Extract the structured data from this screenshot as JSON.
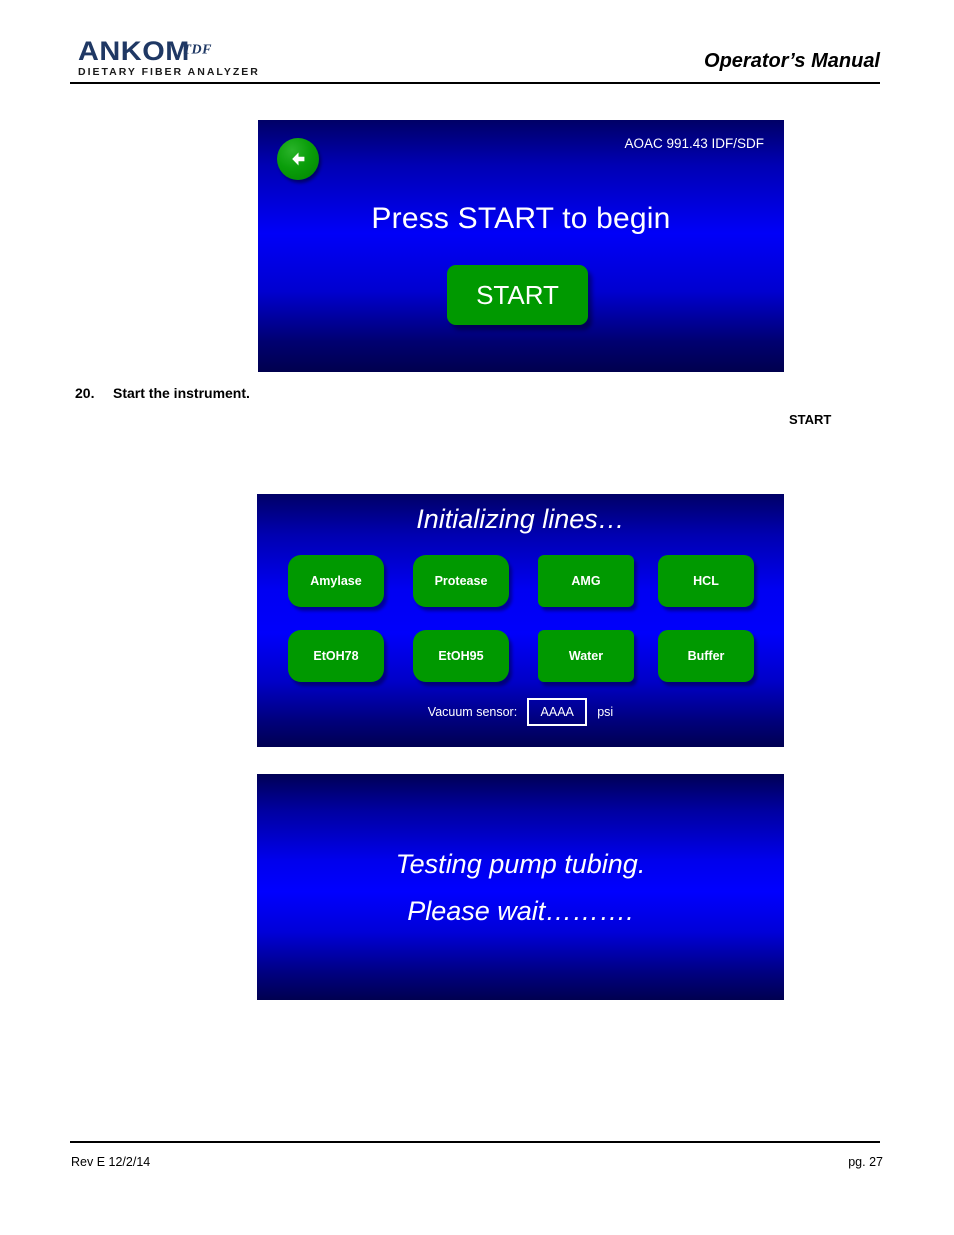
{
  "header": {
    "logo_main": "ANKOM",
    "logo_sup": "TDF",
    "logo_sub": "DIETARY FIBER ANALYZER",
    "title": "Operator’s Manual"
  },
  "screen_start": {
    "back_icon": "back-arrow-icon",
    "method_label": "AOAC 991.43 IDF/SDF",
    "prompt": "Press START to begin",
    "start_button": "START"
  },
  "step": {
    "number": "20.",
    "text": "Start the instrument.",
    "trailing_keyword": "START"
  },
  "screen_initializing": {
    "title": "Initializing lines…",
    "line_buttons": [
      {
        "label": "Amylase"
      },
      {
        "label": "Protease"
      },
      {
        "label": "AMG"
      },
      {
        "label": "HCL"
      },
      {
        "label": "EtOH78"
      },
      {
        "label": "EtOH95"
      },
      {
        "label": "Water"
      },
      {
        "label": "Buffer"
      }
    ],
    "vacuum_label": "Vacuum sensor:",
    "vacuum_value": "AAAA",
    "vacuum_unit": "psi"
  },
  "screen_testing": {
    "line1": "Testing pump tubing.",
    "line2": "Please wait………."
  },
  "footer": {
    "revision": "Rev E 12/2/14",
    "page": "pg. 27"
  },
  "colors": {
    "brand_navy": "#1F3864",
    "screen_blue": "#0000FF",
    "screen_navy": "#000060",
    "button_green": "#009900"
  }
}
